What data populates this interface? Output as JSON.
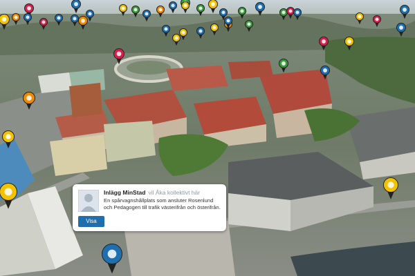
{
  "popup": {
    "author": "Inlägg MinStad",
    "category": "vil Åka kollektivt här",
    "text": "En spårvagnshållplats som ansluter Rosenlund och Pedagogen till trafik västerifrån och österifrån.",
    "button_label": "Visa"
  },
  "colors": {
    "pin_blue": "#1f6fae",
    "pin_green": "#3a9b3a",
    "pin_yellow": "#f2c200",
    "pin_orange": "#f08a00",
    "pin_red": "#d6204c",
    "pin_dark": "#2a2a2a"
  },
  "pins": [
    {
      "kind": "red-icon"
    },
    {
      "kind": "blue-icon"
    },
    {
      "kind": "green-icon"
    },
    {
      "kind": "yellow-icon"
    },
    {
      "kind": "blue-icon"
    },
    {
      "kind": "orange-icon"
    },
    {
      "kind": "blue-icon"
    },
    {
      "kind": "red-icon"
    },
    {
      "kind": "blue-icon"
    },
    {
      "kind": "blue-icon"
    },
    {
      "kind": "blue-icon"
    },
    {
      "kind": "yellow-icon"
    },
    {
      "kind": "green-icon"
    },
    {
      "kind": "blue-icon"
    },
    {
      "kind": "orange-icon"
    },
    {
      "kind": "blue-icon"
    },
    {
      "kind": "yellow-icon"
    },
    {
      "kind": "green-icon"
    },
    {
      "kind": "blue-icon"
    },
    {
      "kind": "green-icon"
    },
    {
      "kind": "yellow-icon"
    },
    {
      "kind": "red-icon"
    },
    {
      "kind": "blue-icon"
    },
    {
      "kind": "orange-icon"
    },
    {
      "kind": "red-icon"
    },
    {
      "kind": "red-icon"
    },
    {
      "kind": "blue-icon"
    },
    {
      "kind": "yellow-icon"
    },
    {
      "kind": "green-icon"
    },
    {
      "kind": "blue-icon"
    },
    {
      "kind": "yellow-icon"
    },
    {
      "kind": "blue-icon"
    },
    {
      "kind": "yellow-icon"
    },
    {
      "kind": "orange-icon"
    },
    {
      "kind": "yellow-icon"
    },
    {
      "kind": "green-icon"
    },
    {
      "kind": "red-icon"
    },
    {
      "kind": "blue-icon"
    },
    {
      "kind": "blue-icon"
    },
    {
      "kind": "green-icon"
    },
    {
      "kind": "orange-icon"
    },
    {
      "kind": "yellow-icon"
    },
    {
      "kind": "yellow-icon"
    },
    {
      "kind": "yellow-icon"
    },
    {
      "kind": "yellow-icon"
    },
    {
      "kind": "blue-icon"
    },
    {
      "kind": "blue-icon"
    }
  ]
}
